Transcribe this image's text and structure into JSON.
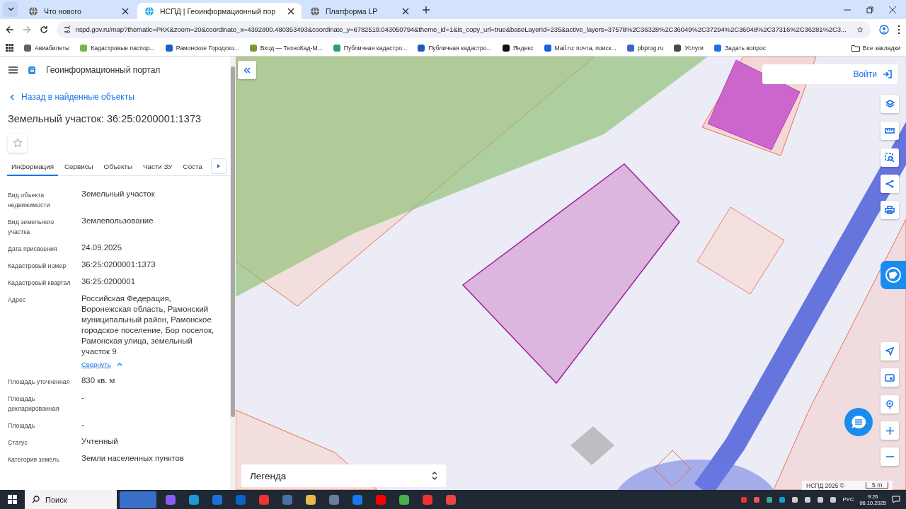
{
  "browser": {
    "tabs": [
      {
        "title": "Что нового",
        "selected": false
      },
      {
        "title": "НСПД | Геоинформационный пор",
        "selected": true
      },
      {
        "title": "Платформа LP",
        "selected": false
      }
    ],
    "url": "nspd.gov.ru/map?thematic=PKK&zoom=20&coordinate_x=4392800.480353493&coordinate_y=6782519.043050794&theme_id=1&is_copy_url=true&baseLayerId=235&active_layers=37578%2C36328%2C36049%2C37294%2C36048%2C37316%2C36281%2C3...",
    "bookmarks": [
      {
        "title": "Авиабилеты",
        "color": "#5f6368"
      },
      {
        "title": "Кадастровые паспор...",
        "color": "#7cb342"
      },
      {
        "title": "Рамонское Городско...",
        "color": "#1565c0"
      },
      {
        "title": "Вход — ТехноКад-М...",
        "color": "#7b9a2e"
      },
      {
        "title": "Публичная кадастро...",
        "color": "#2e9e6e"
      },
      {
        "title": "Публичная кадастро...",
        "color": "#1e5bb8"
      },
      {
        "title": "Яндекс",
        "color": "#111111"
      },
      {
        "title": "Mail.ru: почта, поиск...",
        "color": "#1d5fd8"
      },
      {
        "title": "pbprog.ru",
        "color": "#3a66c4"
      },
      {
        "title": "Услуги",
        "color": "#4a4a4a"
      },
      {
        "title": "Задать вопрос",
        "color": "#1a73e8"
      }
    ],
    "all_bookmarks": "Все закладки"
  },
  "sidebar": {
    "portal_title": "Геоинформационный портал",
    "back_link": "Назад в найденные объекты",
    "heading": "Земельный участок: 36:25:0200001:1373",
    "tabs": [
      {
        "label": "Информация",
        "selected": true
      },
      {
        "label": "Сервисы",
        "selected": false
      },
      {
        "label": "Объекты",
        "selected": false
      },
      {
        "label": "Части ЗУ",
        "selected": false
      },
      {
        "label": "Соста",
        "selected": false
      }
    ],
    "fields": [
      {
        "label": "Вид объекта недвижимости",
        "value": "Земельный участок"
      },
      {
        "label": "Вид земельного участка",
        "value": "Землепользование"
      },
      {
        "label": "Дата присвоения",
        "value": "24.09.2025"
      },
      {
        "label": "Кадастровый номер",
        "value": "36:25:0200001:1373"
      },
      {
        "label": "Кадастровый квартал",
        "value": "36:25:0200001"
      },
      {
        "label": "Адрес",
        "value": "Российская Федерация, Воронежская область, Рамонский муниципальный район, Рамонское городское поселение, Бор поселок, Рамонская улица, земельный участок 9",
        "link": "Свернуть"
      },
      {
        "label": "Площадь уточненная",
        "value": "830 кв. м"
      },
      {
        "label": "Площадь декларированная",
        "value": "-"
      },
      {
        "label": "Площадь",
        "value": "-"
      },
      {
        "label": "Статус",
        "value": "Учтенный"
      },
      {
        "label": "Категория земель",
        "value": "Земли населенных пунктов"
      }
    ]
  },
  "map": {
    "login": "Войти",
    "legend": "Легенда",
    "attribution": "НСПД 2025 ©",
    "scale": "5 m"
  },
  "taskbar": {
    "search": "Поиск",
    "language": "РУС",
    "time": "9:26",
    "date": "06.10.2025"
  }
}
